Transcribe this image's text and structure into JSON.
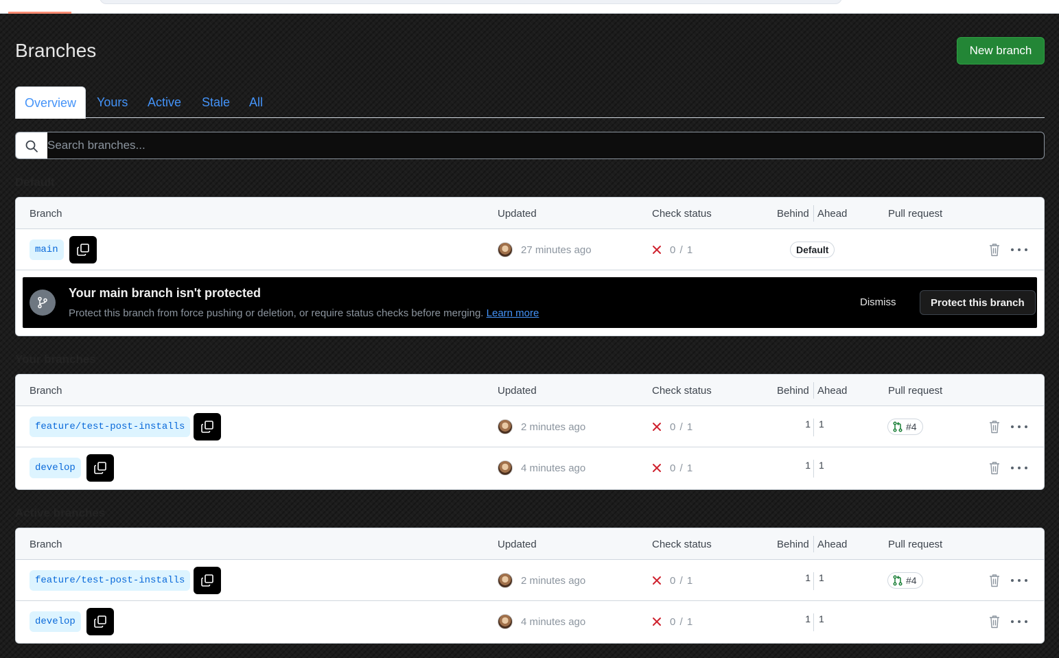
{
  "page": {
    "title": "Branches",
    "new_branch_label": "New branch"
  },
  "tabs": [
    {
      "label": "Overview",
      "selected": true
    },
    {
      "label": "Yours"
    },
    {
      "label": "Active"
    },
    {
      "label": "Stale"
    },
    {
      "label": "All"
    }
  ],
  "search": {
    "placeholder": "Search branches..."
  },
  "columns": {
    "branch": "Branch",
    "updated": "Updated",
    "check_status": "Check status",
    "behind": "Behind",
    "ahead": "Ahead",
    "pull_request": "Pull request"
  },
  "sections": {
    "default": {
      "heading": "Default",
      "rows": [
        {
          "branch": "main",
          "updated": "27 minutes ago",
          "check": "0 / 1",
          "badge": "Default"
        }
      ]
    },
    "yours": {
      "heading": "Your branches",
      "rows": [
        {
          "branch": "feature/test-post-installs",
          "updated": "2 minutes ago",
          "check": "0 / 1",
          "behind": "1",
          "ahead": "1",
          "pr": "#4"
        },
        {
          "branch": "develop",
          "updated": "4 minutes ago",
          "check": "0 / 1",
          "behind": "1",
          "ahead": "1"
        }
      ]
    },
    "active": {
      "heading": "Active branches",
      "rows": [
        {
          "branch": "feature/test-post-installs",
          "updated": "2 minutes ago",
          "check": "0 / 1",
          "behind": "1",
          "ahead": "1",
          "pr": "#4"
        },
        {
          "branch": "develop",
          "updated": "4 minutes ago",
          "check": "0 / 1",
          "behind": "1",
          "ahead": "1"
        }
      ]
    }
  },
  "banner": {
    "title": "Your main branch isn't protected",
    "description": "Protect this branch from force pushing or deletion, or require status checks before merging.",
    "link": "Learn more",
    "dismiss": "Dismiss",
    "protect": "Protect this branch"
  },
  "colors": {
    "accent_green": "#238636",
    "link_blue": "#4493f8",
    "fail_red": "#cf222e",
    "branch_chip_bg": "#ddf4ff",
    "pr_open_green": "#1a7f37"
  }
}
